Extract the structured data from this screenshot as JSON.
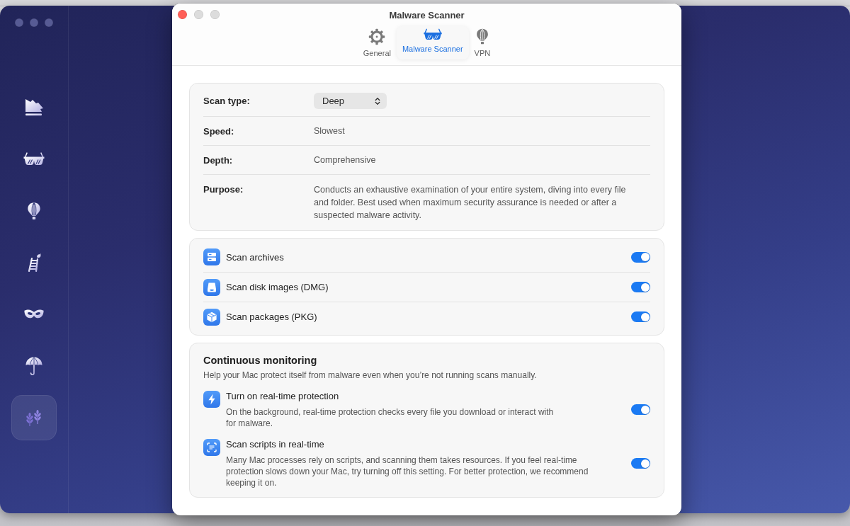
{
  "app_window": {
    "sidebar": {
      "items": [
        {
          "selected": false
        },
        {
          "selected": false
        },
        {
          "selected": false
        },
        {
          "selected": false
        },
        {
          "selected": false
        },
        {
          "selected": false
        },
        {
          "selected": true
        }
      ]
    }
  },
  "settings_window": {
    "title": "Malware Scanner",
    "tabs": [
      {
        "label": "General",
        "selected": false
      },
      {
        "label": "Malware Scanner",
        "selected": true
      },
      {
        "label": "VPN",
        "selected": false
      }
    ],
    "scan_details": [
      {
        "kind": "select",
        "label": "Scan type:",
        "value": "Deep"
      },
      {
        "kind": "text",
        "label": "Speed:",
        "value": "Slowest"
      },
      {
        "kind": "text",
        "label": "Depth:",
        "value": "Comprehensive"
      },
      {
        "kind": "text",
        "label": "Purpose:",
        "value": "Conducts an exhaustive examination of your entire system, diving into every file and folder. Best used when maximum security assurance is needed or after a suspected malware activity."
      }
    ],
    "scan_options": [
      {
        "label": "Scan archives",
        "on": true
      },
      {
        "label": "Scan disk images (DMG)",
        "on": true
      },
      {
        "label": "Scan packages (PKG)",
        "on": true
      }
    ],
    "continuous_monitoring": {
      "title": "Continuous monitoring",
      "description": "Help your Mac protect itself from malware even when you’re not running scans manually.",
      "items": [
        {
          "title": "Turn on real-time protection",
          "description": "On the background, real-time protection checks every file you download or interact with for malware.",
          "on": true
        },
        {
          "title": "Scan scripts in real-time",
          "description": "Many Mac processes rely on scripts, and scanning them takes resources. If you feel real-time protection slows down your Mac, try turning off this setting. For better protection, we recommend keeping it on.",
          "on": true
        }
      ]
    }
  }
}
